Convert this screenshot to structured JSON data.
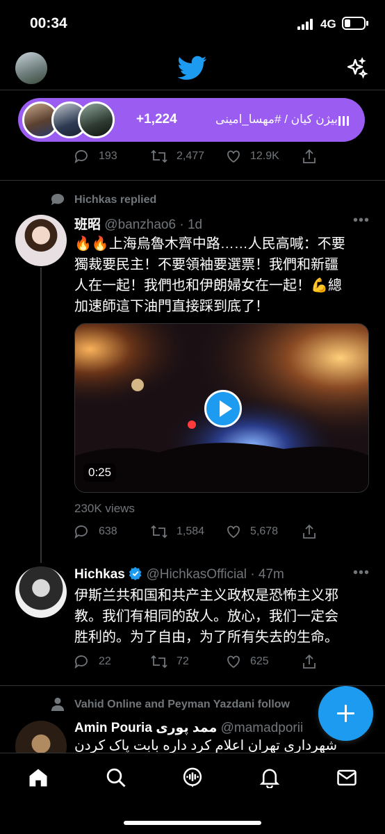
{
  "status": {
    "time": "00:34",
    "network": "4G",
    "battery_level": 0.3
  },
  "topbar": {
    "logo": "twitter-bird-icon",
    "right_icon": "sparkle-icon"
  },
  "spaces": {
    "listener_count": "+1,224",
    "title": "بیژن کیان / #مهسا_امینی",
    "accent": "#9b5cf2"
  },
  "prev_tweet": {
    "replies": "193",
    "retweets": "2,477",
    "likes": "12.9K"
  },
  "tweet1": {
    "context": "Hichkas replied",
    "name": "班昭",
    "handle": "@banzhao6",
    "time": "· 1d",
    "text_lines": [
      "🔥🔥上海烏魯木齊中路……人民高喊：不要",
      "獨裁要民主！不要領袖要選票！我們和新疆",
      "人在一起！我們也和伊朗婦女在一起！💪總",
      "加速師這下油門直接踩到底了！"
    ],
    "video_duration": "0:25",
    "views": "230K views",
    "replies": "638",
    "retweets": "1,584",
    "likes": "5,678"
  },
  "tweet2": {
    "name": "Hichkas",
    "handle": "@HichkasOfficial",
    "time": "· 47m",
    "text_lines": [
      "伊斯兰共和国和共产主义政权是恐怖主义邪",
      "教。我们有相同的敌人。放心，我们一定会",
      "胜利的。为了自由，为了所有失去的生命。"
    ],
    "replies": "22",
    "retweets": "72",
    "likes": "625",
    "verified_color": "#1d9bf0"
  },
  "tweet3": {
    "context": "Vahid Online and Peyman Yazdani follow",
    "name": "Amin Pouria ممد پوری",
    "handle": "@mamadporii",
    "text_line": "شهرداری تهران اعلام کرد داره بابت پاک کردن"
  },
  "colors": {
    "accent": "#1d9bf0",
    "muted": "#71767b",
    "background": "#000000"
  }
}
